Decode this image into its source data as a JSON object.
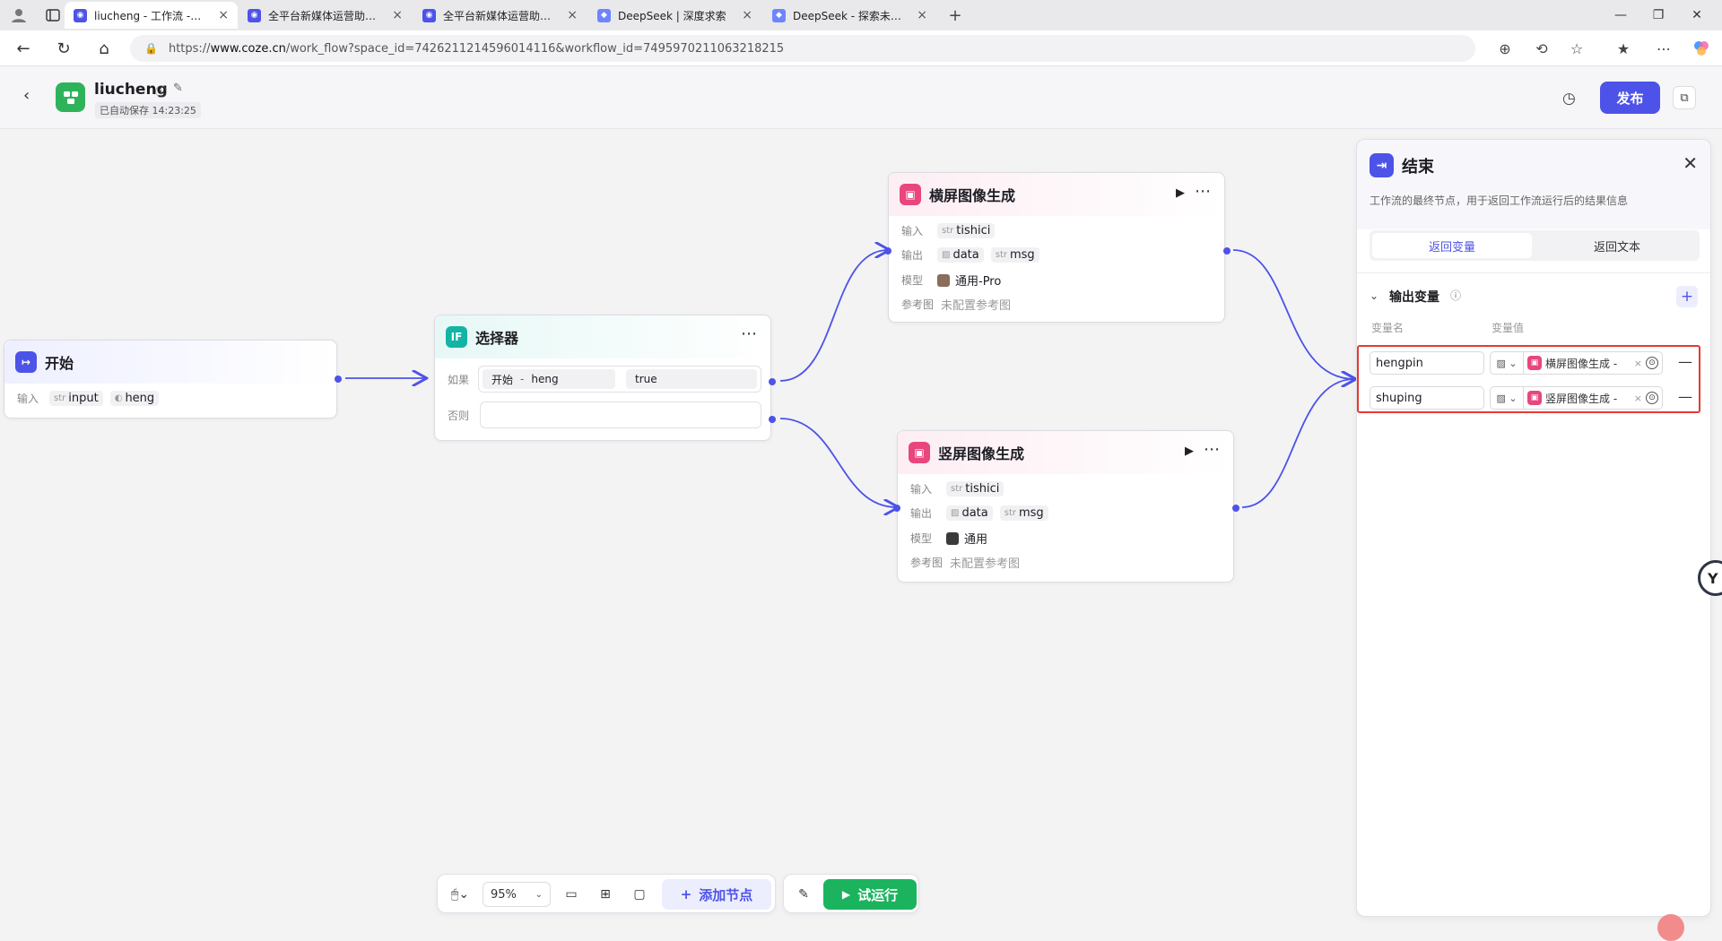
{
  "browser": {
    "tabs": [
      {
        "label": "liucheng - 工作流 -智能体平台",
        "active": true,
        "favicon_color": "#4d53e8"
      },
      {
        "label": "全平台新媒体运营助手 -智能体 -",
        "active": false,
        "favicon_color": "#4d53e8"
      },
      {
        "label": "全平台新媒体运营助手 -智能体 -",
        "active": false,
        "favicon_color": "#4d53e8"
      },
      {
        "label": "DeepSeek | 深度求索",
        "active": false,
        "favicon_color": "#4d6bfe"
      },
      {
        "label": "DeepSeek - 探索未至之境",
        "active": false,
        "favicon_color": "#4d6bfe"
      }
    ],
    "url_prefix": "https://",
    "url_host": "www.coze.cn",
    "url_path": "/work_flow?space_id=7426211214596014116&workflow_id=7495970211063218215"
  },
  "header": {
    "app_name": "liucheng",
    "autosave": "已自动保存 14:23:25",
    "publish_label": "发布"
  },
  "nodes": {
    "start": {
      "title": "开始",
      "input_label": "输入",
      "inputs": [
        {
          "type": "str",
          "name": "input"
        },
        {
          "type": "bool-icon",
          "name": "heng"
        }
      ]
    },
    "selector": {
      "title": "选择器",
      "icon_text": "IF",
      "if_label": "如果",
      "condition_left_prefix": "开始",
      "condition_sep": "-",
      "condition_left_var": "heng",
      "condition_right": "true",
      "else_label": "否则"
    },
    "landscape": {
      "title": "横屏图像生成",
      "input_label": "输入",
      "input": {
        "type": "str",
        "name": "tishici"
      },
      "output_label": "输出",
      "outputs": [
        {
          "type": "image-icon",
          "name": "data"
        },
        {
          "type": "str",
          "name": "msg"
        }
      ],
      "model_label": "模型",
      "model": "通用-Pro",
      "ref_label": "参考图",
      "ref_value": "未配置参考图"
    },
    "portrait": {
      "title": "竖屏图像生成",
      "input_label": "输入",
      "input": {
        "type": "str",
        "name": "tishici"
      },
      "output_label": "输出",
      "outputs": [
        {
          "type": "image-icon",
          "name": "data"
        },
        {
          "type": "str",
          "name": "msg"
        }
      ],
      "model_label": "模型",
      "model": "通用",
      "ref_label": "参考图",
      "ref_value": "未配置参考图"
    }
  },
  "panel": {
    "title": "结束",
    "description": "工作流的最终节点，用于返回工作流运行后的结果信息",
    "tabs": [
      {
        "label": "返回变量",
        "active": true
      },
      {
        "label": "返回文本",
        "active": false
      }
    ],
    "section_title": "输出变量",
    "col_name": "变量名",
    "col_value": "变量值",
    "variables": [
      {
        "name": "hengpin",
        "value": "横屏图像生成 -"
      },
      {
        "name": "shuping",
        "value": "竖屏图像生成 -"
      }
    ]
  },
  "toolbar": {
    "zoom": "95%",
    "add_node_label": "添加节点",
    "try_run_label": "试运行"
  },
  "colors": {
    "accent": "#4d53e8",
    "run_green": "#1bb35e",
    "highlight_red": "#e53935",
    "image_node_pink": "#e8467c",
    "if_node_teal": "#12b4a6"
  }
}
